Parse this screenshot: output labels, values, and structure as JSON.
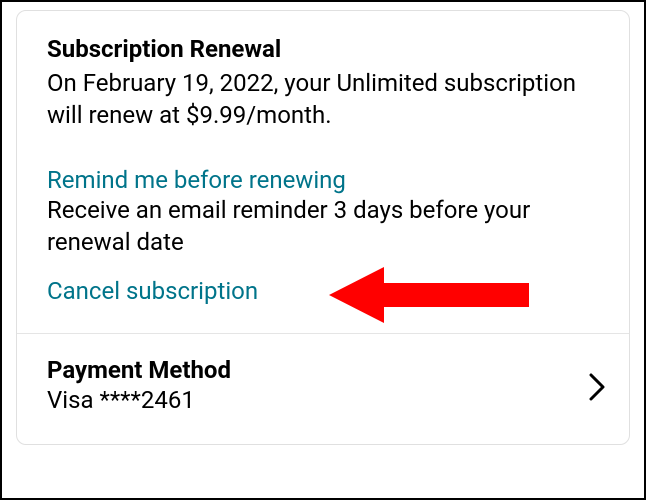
{
  "renewal": {
    "heading": "Subscription Renewal",
    "description": "On February 19, 2022, your Unlimited subscription will renew at $9.99/month."
  },
  "reminder": {
    "link_label": "Remind me before renewing",
    "description": "Receive an email reminder 3 days before your renewal date"
  },
  "cancel": {
    "link_label": "Cancel subscription"
  },
  "payment": {
    "heading": "Payment Method",
    "value": "Visa  ****2461"
  },
  "colors": {
    "link": "#00748a",
    "annotation_arrow": "#ff0000"
  }
}
